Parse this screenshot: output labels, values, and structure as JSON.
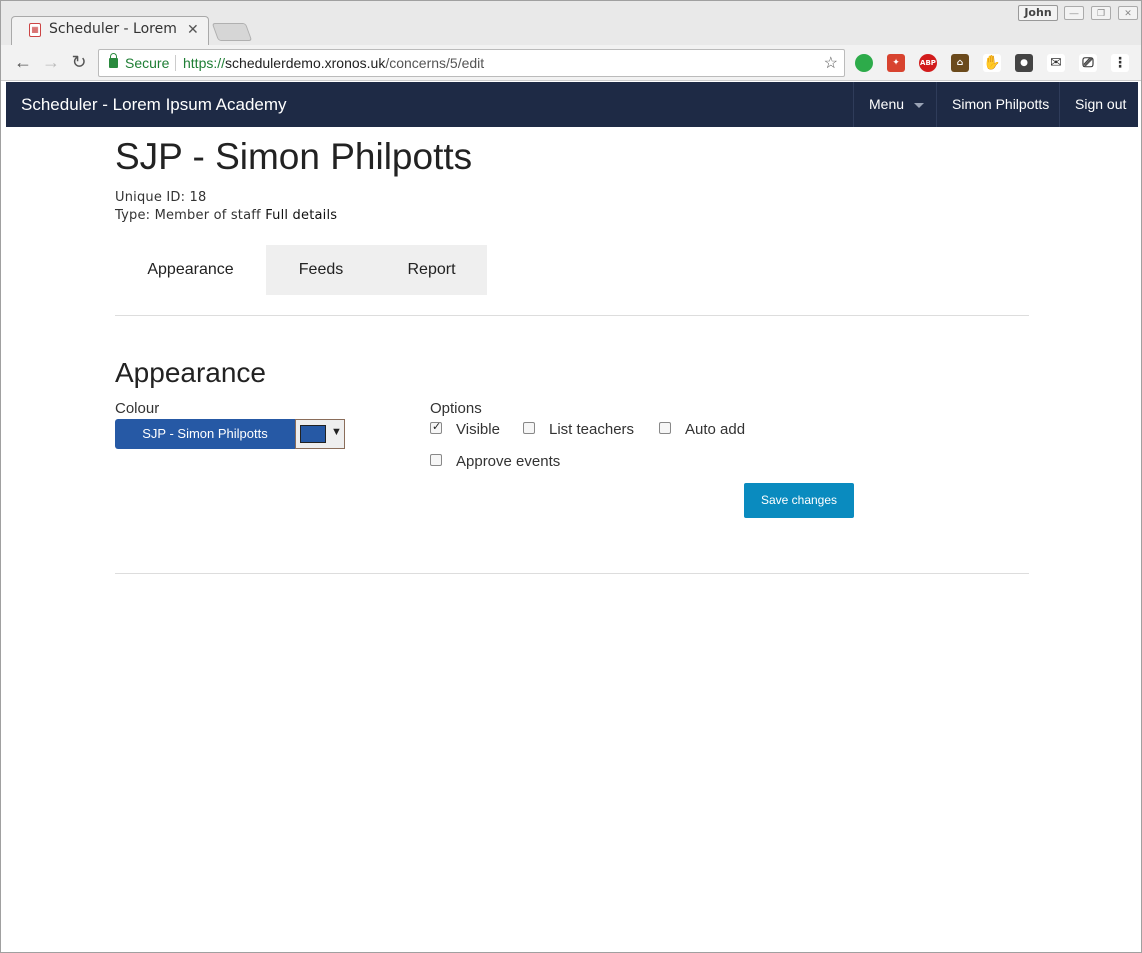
{
  "browser": {
    "tab_title": "Scheduler - Lorem Ipsum Academy",
    "profile_name": "John",
    "secure_label": "Secure",
    "url_scheme": "https://",
    "url_host": "schedulerdemo.xronos.uk",
    "url_path": "/concerns/5/edit",
    "extensions": [
      "evernote-icon",
      "mendeley-icon",
      "adblock-plus-icon",
      "extension-house-icon",
      "gnome-icon",
      "lightbulb-icon",
      "mail-check-icon",
      "cast-icon",
      "menu-icon"
    ]
  },
  "navbar": {
    "brand": "Scheduler - Lorem Ipsum Academy",
    "menu_label": "Menu",
    "user_label": "Simon Philpotts",
    "signout_label": "Sign out",
    "bg_color": "#1e2a45"
  },
  "page": {
    "title": "SJP - Simon Philpotts",
    "unique_id_label": "Unique ID: 18",
    "type_label": "Type: Member of staff",
    "full_details_link": "Full details"
  },
  "tabs": [
    {
      "label": "Appearance",
      "active": true
    },
    {
      "label": "Feeds",
      "active": false
    },
    {
      "label": "Report",
      "active": false
    }
  ],
  "appearance": {
    "heading": "Appearance",
    "colour_label": "Colour",
    "colour_button_text": "SJP - Simon Philpotts",
    "colour_value": "#2659a5",
    "options_label": "Options",
    "options": [
      {
        "label": "Visible",
        "checked": true
      },
      {
        "label": "List teachers",
        "checked": false
      },
      {
        "label": "Auto add",
        "checked": false
      },
      {
        "label": "Approve events",
        "checked": false
      }
    ],
    "save_label": "Save changes",
    "save_color": "#0a8bbf"
  }
}
